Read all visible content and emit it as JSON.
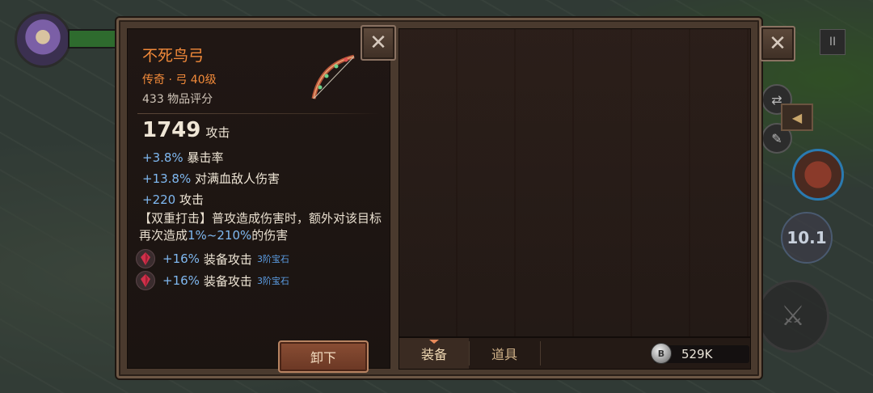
{
  "hud": {
    "pause_label": "II",
    "cooldown_value": "10.1",
    "back_label": "◀"
  },
  "item": {
    "name": "不死鸟弓",
    "rarity_line": "传奇 · 弓 40级",
    "score_line": "433 物品评分",
    "icon": "bow-icon",
    "main_stat": {
      "value": "1749",
      "label": "攻击"
    },
    "substats": [
      {
        "value": "+3.8%",
        "label": "暴击率"
      },
      {
        "value": "+13.8%",
        "label": "对满血敌人伤害"
      },
      {
        "value": "+220",
        "label": "攻击"
      }
    ],
    "effect": {
      "part1": "【双重打击】普攻造成伤害时，额外对该目标再次造成",
      "highlight": "1%~210%",
      "part2": "的伤害"
    },
    "gems": [
      {
        "value": "+16%",
        "label": "装备攻击",
        "tier": "3阶宝石",
        "icon": "ruby-gem-icon"
      },
      {
        "value": "+16%",
        "label": "装备攻击",
        "tier": "3阶宝石",
        "icon": "ruby-gem-icon"
      }
    ],
    "unequip_label": "卸下"
  },
  "tabs": [
    {
      "label": "装备",
      "active": true
    },
    {
      "label": "道具",
      "active": false
    }
  ],
  "currency": {
    "icon": "silver-coin-icon",
    "symbol": "B",
    "value": "529K"
  },
  "close_symbol": "✕",
  "colors": {
    "legendary": "#f28a3a",
    "stat_value": "#7fb8f0",
    "gem_tier": "#5c9ee6",
    "panel_bg": "#201714"
  }
}
